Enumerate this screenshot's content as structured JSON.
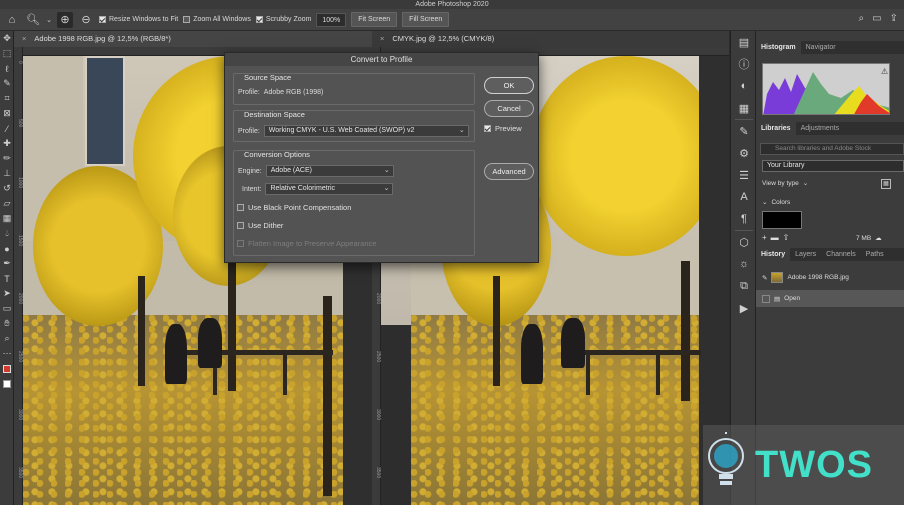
{
  "window": {
    "title": "Adobe Photoshop 2020"
  },
  "options_bar": {
    "resize_windows_label": "Resize Windows to Fit",
    "zoom_all_label": "Zoom All Windows",
    "scrubby_zoom_label": "Scrubby Zoom",
    "zoom_value": "100%",
    "fit_screen": "Fit Screen",
    "fill_screen": "Fill Screen",
    "checks": {
      "resize_windows": true,
      "zoom_all": false,
      "scrubby_zoom": true
    }
  },
  "doc_tabs": [
    {
      "label": "Adobe 1998 RGB.jpg @ 12,5% (RGB/8*)"
    },
    {
      "label": "CMYK.jpg @ 12,5% (CMYK/8)"
    }
  ],
  "rulers": {
    "left_doc": [
      "0",
      "500",
      "1000",
      "1500",
      "2000",
      "2500",
      "3000",
      "3500"
    ],
    "right_doc": [
      "0",
      "500",
      "1000",
      "1500",
      "2000",
      "2500",
      "3000",
      "3500"
    ]
  },
  "dialog": {
    "title": "Convert to Profile",
    "source_space": {
      "title": "Source Space",
      "profile_label": "Profile:",
      "profile_value": "Adobe RGB (1998)"
    },
    "destination_space": {
      "title": "Destination Space",
      "profile_label": "Profile:",
      "profile_value": "Working CMYK - U.S. Web Coated (SWOP) v2"
    },
    "conversion_options": {
      "title": "Conversion Options",
      "engine_label": "Engine:",
      "engine_value": "Adobe (ACE)",
      "intent_label": "Intent:",
      "intent_value": "Relative Colorimetric",
      "black_point_label": "Use Black Point Compensation",
      "dither_label": "Use Dither",
      "flatten_label": "Flatten Image to Preserve Appearance"
    },
    "buttons": {
      "ok": "OK",
      "cancel": "Cancel",
      "advanced": "Advanced"
    },
    "preview_label": "Preview",
    "checks": {
      "preview": true,
      "black_point": false,
      "dither": false,
      "flatten": false
    }
  },
  "panel": {
    "top_tabs": [
      "Histogram",
      "Navigator"
    ],
    "lib_tabs": [
      "Libraries",
      "Adjustments"
    ],
    "search_placeholder": "Search libraries and Adobe Stock",
    "library_select": "Your Library",
    "view_by": "View by type",
    "colors_label": "Colors",
    "size_label": "7 MB",
    "history_tabs": [
      "History",
      "Layers",
      "Channels",
      "Paths"
    ],
    "history_items": [
      "Adobe 1998 RGB.jpg",
      "Open"
    ]
  },
  "watermark": {
    "text": "TWOS"
  }
}
